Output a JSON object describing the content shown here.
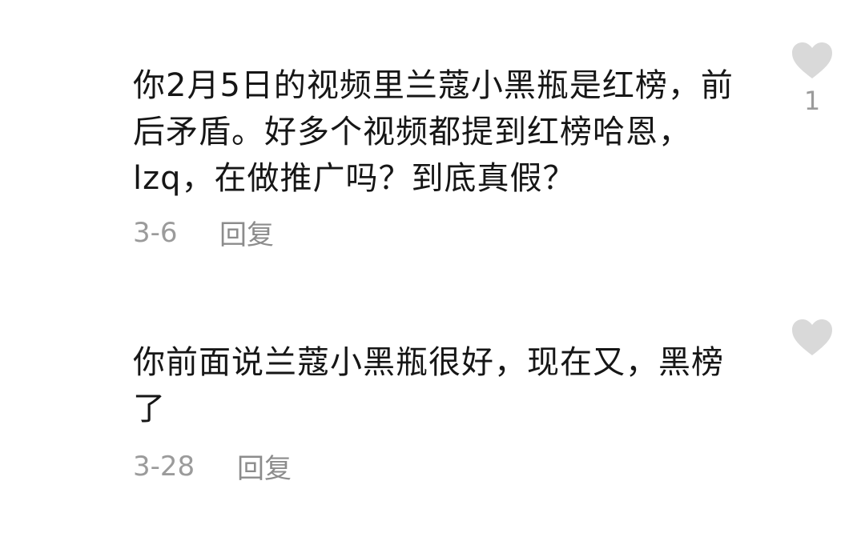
{
  "comments": [
    {
      "text": "你2月5日的视频里兰蔻小黑瓶是红榜，前后矛盾。好多个视频都提到红榜哈恩，lzq，在做推广吗？到底真假？",
      "lines": [
        "你2月5日的视频里兰蔻小黑瓶是红榜，前",
        "后矛盾。好多个视频都提到红榜哈恩，",
        "lzq，在做推广吗？到底真假？"
      ],
      "date": "3-6",
      "reply_label": "回复",
      "like_count": "1"
    },
    {
      "text": "你前面说兰蔻小黑瓶很好，现在又，黑榜了",
      "lines": [
        "你前面说兰蔻小黑瓶很好，现在又，黑榜",
        "了"
      ],
      "date": "3-28",
      "reply_label": "回复",
      "like_count": ""
    }
  ],
  "icons": {
    "like": "heart-icon"
  },
  "colors": {
    "text": "#161616",
    "meta": "#9b9b9b",
    "heart": "#d9d9d9"
  }
}
